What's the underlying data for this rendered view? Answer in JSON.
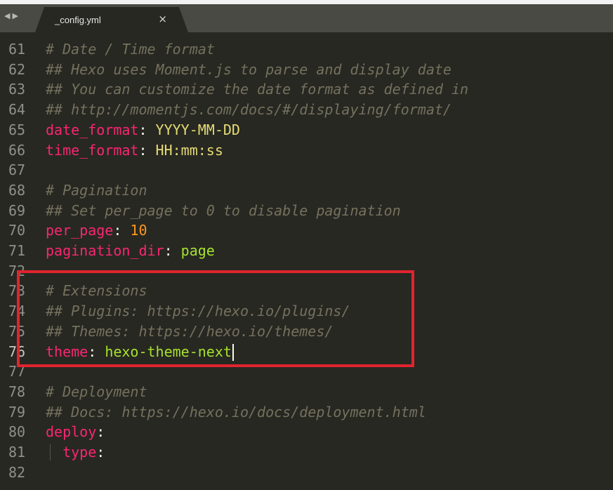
{
  "tabs": {
    "active": {
      "title": "_config.yml",
      "close": "×"
    },
    "nav_back": "◀",
    "nav_forward": "▶"
  },
  "lines": [
    {
      "num": "61",
      "parts": [
        {
          "t": "# Date / Time format",
          "c": "comment"
        }
      ]
    },
    {
      "num": "62",
      "parts": [
        {
          "t": "## Hexo uses Moment.js to parse and display date",
          "c": "comment"
        }
      ]
    },
    {
      "num": "63",
      "parts": [
        {
          "t": "## You can customize the date format as defined in",
          "c": "comment"
        }
      ]
    },
    {
      "num": "64",
      "parts": [
        {
          "t": "## http://momentjs.com/docs/#/displaying/format/",
          "c": "comment"
        }
      ]
    },
    {
      "num": "65",
      "parts": [
        {
          "t": "date_format",
          "c": "key"
        },
        {
          "t": ": ",
          "c": "punct"
        },
        {
          "t": "YYYY-MM-DD",
          "c": "str"
        }
      ]
    },
    {
      "num": "66",
      "parts": [
        {
          "t": "time_format",
          "c": "key"
        },
        {
          "t": ": ",
          "c": "punct"
        },
        {
          "t": "HH:mm:ss",
          "c": "str"
        }
      ]
    },
    {
      "num": "67",
      "parts": []
    },
    {
      "num": "68",
      "parts": [
        {
          "t": "# Pagination",
          "c": "comment"
        }
      ]
    },
    {
      "num": "69",
      "parts": [
        {
          "t": "## Set per_page to 0 to disable pagination",
          "c": "comment"
        }
      ]
    },
    {
      "num": "70",
      "parts": [
        {
          "t": "per_page",
          "c": "key"
        },
        {
          "t": ": ",
          "c": "punct"
        },
        {
          "t": "10",
          "c": "num"
        }
      ]
    },
    {
      "num": "71",
      "parts": [
        {
          "t": "pagination_dir",
          "c": "key"
        },
        {
          "t": ": ",
          "c": "punct"
        },
        {
          "t": "page",
          "c": "plain"
        }
      ]
    },
    {
      "num": "72",
      "parts": []
    },
    {
      "num": "73",
      "parts": [
        {
          "t": "# Extensions",
          "c": "comment"
        }
      ]
    },
    {
      "num": "74",
      "parts": [
        {
          "t": "## Plugins: https://hexo.io/plugins/",
          "c": "comment"
        }
      ]
    },
    {
      "num": "75",
      "parts": [
        {
          "t": "## Themes: https://hexo.io/themes/",
          "c": "comment"
        }
      ]
    },
    {
      "num": "76",
      "active": true,
      "cursor": true,
      "parts": [
        {
          "t": "theme",
          "c": "key"
        },
        {
          "t": ": ",
          "c": "punct"
        },
        {
          "t": "hexo-theme-next",
          "c": "plain"
        }
      ]
    },
    {
      "num": "77",
      "parts": []
    },
    {
      "num": "78",
      "parts": [
        {
          "t": "# Deployment",
          "c": "comment"
        }
      ]
    },
    {
      "num": "79",
      "parts": [
        {
          "t": "## Docs: https://hexo.io/docs/deployment.html",
          "c": "comment"
        }
      ]
    },
    {
      "num": "80",
      "parts": [
        {
          "t": "deploy",
          "c": "key"
        },
        {
          "t": ":",
          "c": "punct"
        }
      ]
    },
    {
      "num": "81",
      "parts": [
        {
          "t": "  type",
          "c": "key"
        },
        {
          "t": ":",
          "c": "punct"
        }
      ]
    },
    {
      "num": "82",
      "parts": []
    }
  ],
  "colors": {
    "background": "#272822",
    "comment": "#75715e",
    "key": "#f92672",
    "string": "#e6db74",
    "number": "#fd971f",
    "value": "#a6e22e",
    "annotation_box": "#e0242e"
  }
}
